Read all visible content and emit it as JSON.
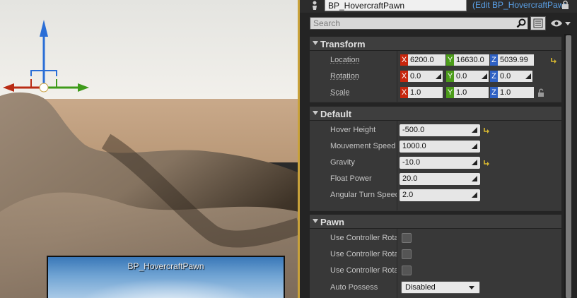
{
  "viewport": {
    "sub_viewport_label": "BP_HovercraftPawn"
  },
  "details": {
    "name_value": "BP_HovercraftPawn",
    "edit_link": "(Edit BP_HovercraftPawn)",
    "search_placeholder": "Search",
    "sections": {
      "transform": {
        "title": "Transform",
        "location": {
          "label": "Location",
          "x": "6200.0",
          "y": "16630.0",
          "z": "5039.99"
        },
        "rotation": {
          "label": "Rotation",
          "x": "0.0",
          "y": "0.0",
          "z": "0.0"
        },
        "scale": {
          "label": "Scale",
          "x": "1.0",
          "y": "1.0",
          "z": "1.0"
        }
      },
      "default": {
        "title": "Default",
        "rows": [
          {
            "label": "Hover Height",
            "value": "-500.0"
          },
          {
            "label": "Mouvement Speed",
            "value": "1000.0"
          },
          {
            "label": "Gravity",
            "value": "-10.0"
          },
          {
            "label": "Float Power",
            "value": "20.0"
          },
          {
            "label": "Angular Turn Speed",
            "value": "2.0"
          }
        ]
      },
      "pawn": {
        "title": "Pawn",
        "rows": [
          {
            "label": "Use Controller Rotation Pitch"
          },
          {
            "label": "Use Controller Rotation Yaw"
          },
          {
            "label": "Use Controller Rotation Roll"
          }
        ],
        "auto_possess": {
          "label": "Auto Possess",
          "value": "Disabled"
        }
      }
    },
    "axis_labels": {
      "x": "X",
      "y": "Y",
      "z": "Z"
    }
  },
  "colors": {
    "axis_x": "#c8260d",
    "axis_y": "#4c9c1a",
    "axis_z": "#2f61c4",
    "viewport_border": "#c9a23a",
    "link": "#5aa0e6"
  }
}
